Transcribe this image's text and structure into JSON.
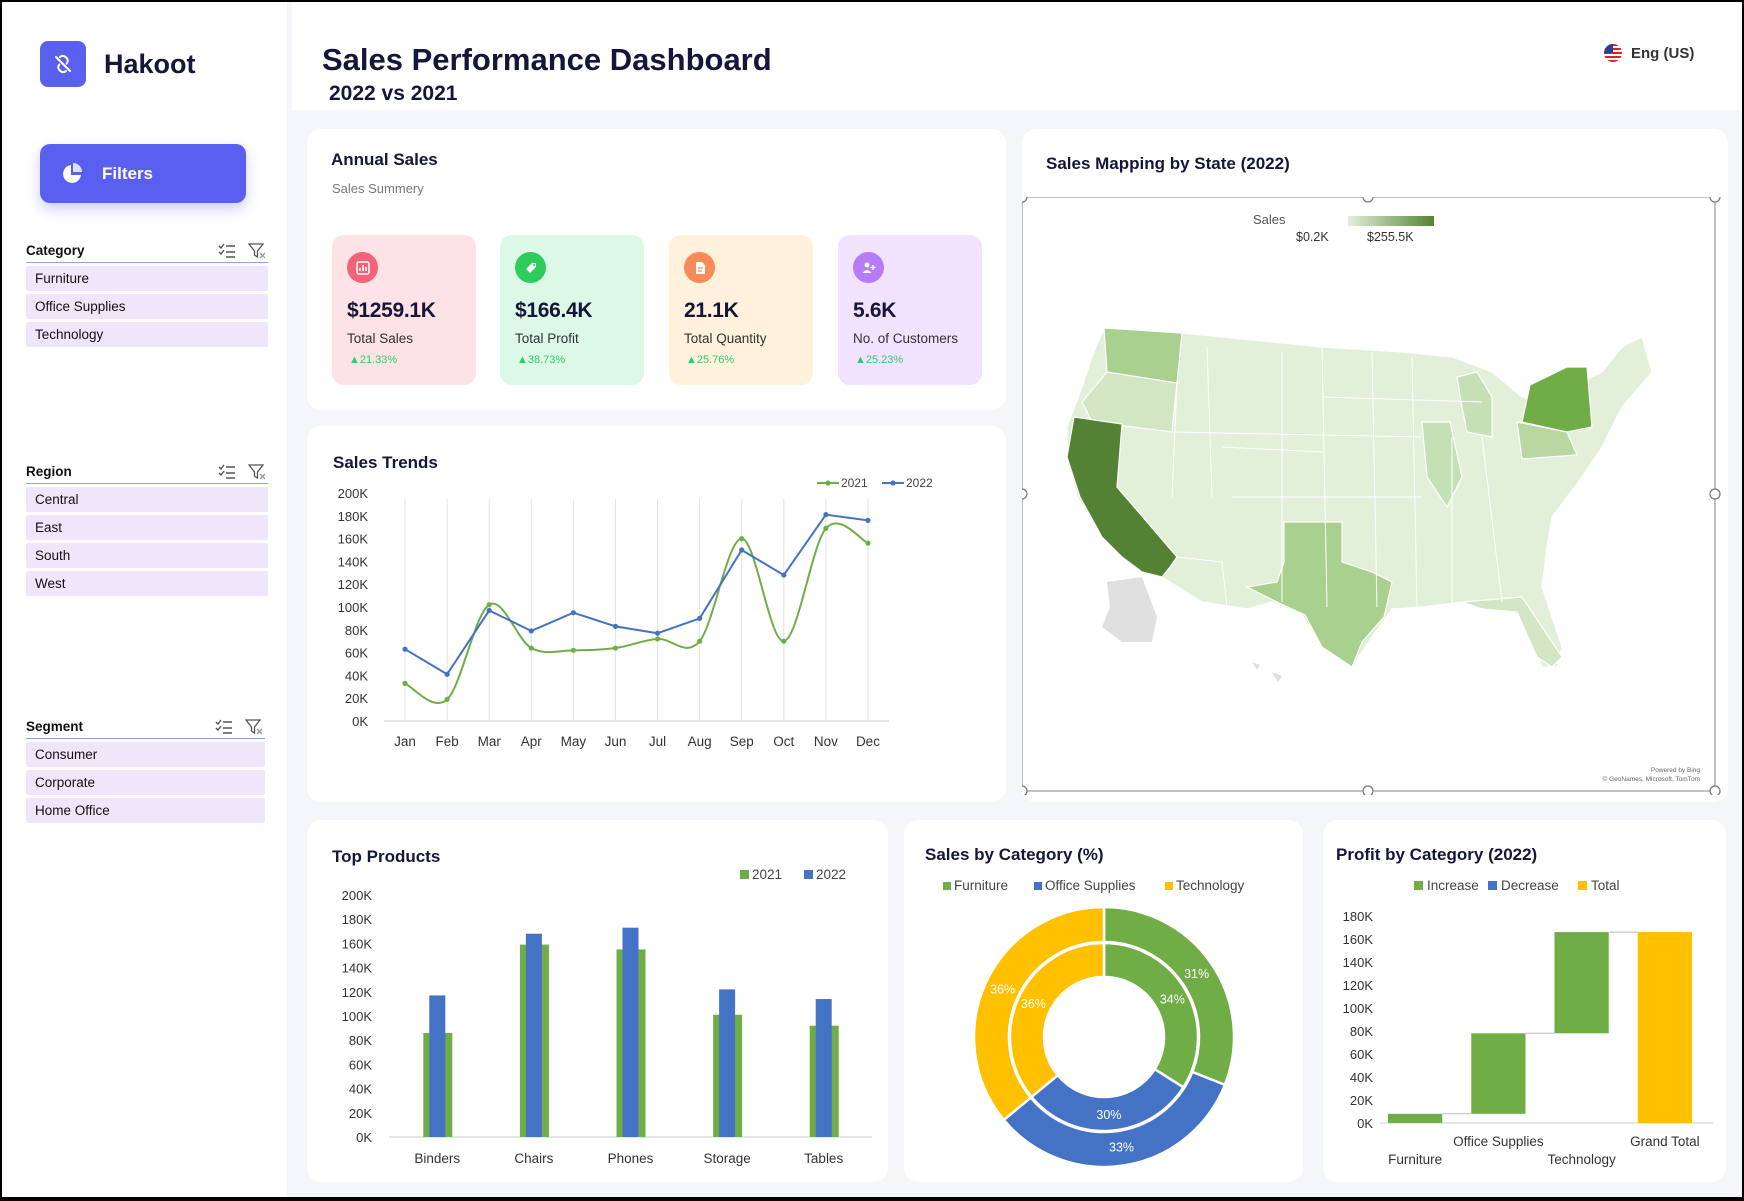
{
  "brand": {
    "name": "Hakoot",
    "logo_icon": "link-slash-icon"
  },
  "filters": {
    "label": "Filters",
    "icon": "pie-icon"
  },
  "slicers": {
    "category": {
      "title": "Category",
      "items": [
        "Furniture",
        "Office Supplies",
        "Technology"
      ]
    },
    "region": {
      "title": "Region",
      "items": [
        "Central",
        "East",
        "South",
        "West"
      ]
    },
    "segment": {
      "title": "Segment",
      "items": [
        "Consumer",
        "Corporate",
        "Home Office"
      ]
    }
  },
  "header": {
    "title": "Sales Performance Dashboard",
    "subtitle": "2022 vs 2021",
    "language": "Eng (US)"
  },
  "annual": {
    "title": "Annual Sales",
    "subtitle": "Sales Summery",
    "kpis": [
      {
        "value": "$1259.1K",
        "label": "Total Sales",
        "change": "▲21.33%",
        "bg": "#fde2e6",
        "icon_bg": "#f4627a",
        "icon": "bar-chart-icon"
      },
      {
        "value": "$166.4K",
        "label": "Total Profit",
        "change": "▲38.73%",
        "bg": "#dcf8e6",
        "icon_bg": "#2ecc5b",
        "icon": "tag-icon"
      },
      {
        "value": "21.1K",
        "label": "Total Quantity",
        "change": "▲25.76%",
        "bg": "#fff1dc",
        "icon_bg": "#fa8a5a",
        "icon": "document-icon"
      },
      {
        "value": "5.6K",
        "label": "No. of Customers",
        "change": "▲25.23%",
        "bg": "#f1e2fd",
        "icon_bg": "#b77cf5",
        "icon": "add-user-icon"
      }
    ]
  },
  "colors": {
    "green": "#70ad47",
    "blue": "#4472c4",
    "yellow": "#ffc000",
    "accent": "#5a5ff0",
    "navy": "#14163a"
  },
  "map": {
    "title": "Sales Mapping by State (2022)",
    "legend_label": "Sales",
    "legend_min": "$0.2K",
    "legend_max": "$255.5K",
    "credit_1": "Powered by Bing",
    "credit_2": "© GeoNames, Microsoft, TomTom"
  },
  "chart_data": [
    {
      "id": "trends",
      "type": "line",
      "title": "Sales Trends",
      "categories": [
        "Jan",
        "Feb",
        "Mar",
        "Apr",
        "May",
        "Jun",
        "Jul",
        "Aug",
        "Sep",
        "Oct",
        "Nov",
        "Dec"
      ],
      "series": [
        {
          "name": "2021",
          "color": "#70ad47",
          "values": [
            33000,
            19000,
            102000,
            64000,
            62000,
            64000,
            72000,
            70000,
            160000,
            70000,
            169000,
            156000
          ]
        },
        {
          "name": "2022",
          "color": "#4472c4",
          "values": [
            63000,
            41000,
            97000,
            79000,
            95000,
            83000,
            77000,
            90000,
            150000,
            128000,
            181000,
            176000
          ]
        }
      ],
      "ylim": [
        0,
        200000
      ],
      "yticks": [
        "0K",
        "20K",
        "40K",
        "60K",
        "80K",
        "100K",
        "120K",
        "140K",
        "160K",
        "180K",
        "200K"
      ],
      "grid": "vertical"
    },
    {
      "id": "products",
      "type": "bar",
      "title": "Top Products",
      "categories": [
        "Binders",
        "Chairs",
        "Phones",
        "Storage",
        "Tables"
      ],
      "series": [
        {
          "name": "2021",
          "color": "#70ad47",
          "values": [
            86000,
            159000,
            155000,
            101000,
            92000
          ]
        },
        {
          "name": "2022",
          "color": "#4472c4",
          "values": [
            117000,
            168000,
            173000,
            122000,
            114000
          ]
        }
      ],
      "ylim": [
        0,
        200000
      ],
      "yticks": [
        "0K",
        "20K",
        "40K",
        "60K",
        "80K",
        "100K",
        "120K",
        "140K",
        "160K",
        "180K",
        "200K"
      ]
    },
    {
      "id": "category_pct",
      "type": "pie",
      "title": "Sales by Category (%)",
      "legend": [
        {
          "name": "Furniture",
          "color": "#70ad47"
        },
        {
          "name": "Office Supplies",
          "color": "#4472c4"
        },
        {
          "name": "Technology",
          "color": "#ffc000"
        }
      ],
      "outer": {
        "values": [
          31,
          33,
          36
        ],
        "labels": [
          "31%",
          "33%",
          "36%"
        ]
      },
      "inner": {
        "values": [
          34,
          30,
          36
        ],
        "labels": [
          "34%",
          "30%",
          "36%"
        ]
      }
    },
    {
      "id": "profit",
      "type": "bar",
      "subtype": "waterfall",
      "title": "Profit by Category (2022)",
      "legend": [
        {
          "name": "Increase",
          "color": "#70ad47"
        },
        {
          "name": "Decrease",
          "color": "#4472c4"
        },
        {
          "name": "Total",
          "color": "#ffc000"
        }
      ],
      "categories": [
        "Furniture",
        "Office Supplies",
        "Technology",
        "Grand Total"
      ],
      "steps": [
        {
          "from": 0,
          "to": 8000,
          "kind": "Increase"
        },
        {
          "from": 8000,
          "to": 78000,
          "kind": "Increase"
        },
        {
          "from": 78000,
          "to": 166000,
          "kind": "Increase"
        },
        {
          "from": 0,
          "to": 166000,
          "kind": "Total"
        }
      ],
      "ylim": [
        0,
        180000
      ],
      "yticks": [
        "0K",
        "20K",
        "40K",
        "60K",
        "80K",
        "100K",
        "120K",
        "140K",
        "160K",
        "180K"
      ]
    }
  ]
}
